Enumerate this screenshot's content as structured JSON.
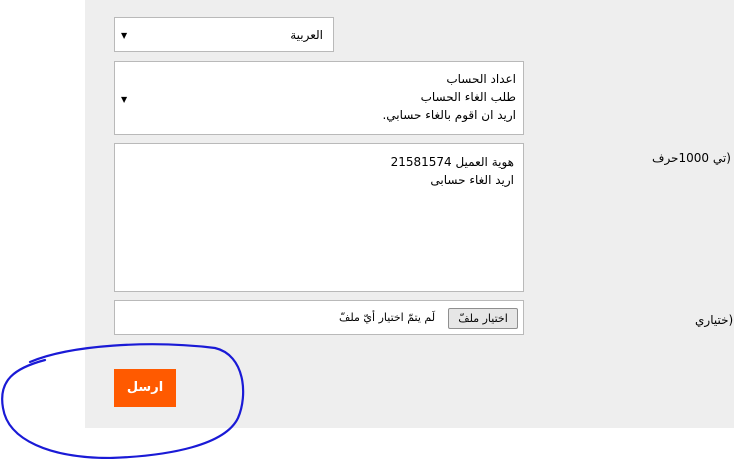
{
  "form": {
    "language_select": {
      "value": "العربية"
    },
    "category_select": {
      "lines": [
        "اعداد الحساب",
        "طلب الغاء الحساب",
        "اريد ان اقوم بالغاء حسابي."
      ]
    },
    "message": {
      "label": "تي 1000حرف)",
      "required_mark": "*",
      "value": "هوية العميل 21581574\nاريد الغاء حسابى"
    },
    "attachment": {
      "label": "ختياري)",
      "button_label": "اختيار ملفّ",
      "status": "لَم يتمّ اختيار أيّ ملفّ"
    },
    "submit_label": "ارسل"
  },
  "colors": {
    "submit_bg": "#ff5a00",
    "annotation": "#1a1ad6",
    "panel_bg": "#eeeeee"
  }
}
